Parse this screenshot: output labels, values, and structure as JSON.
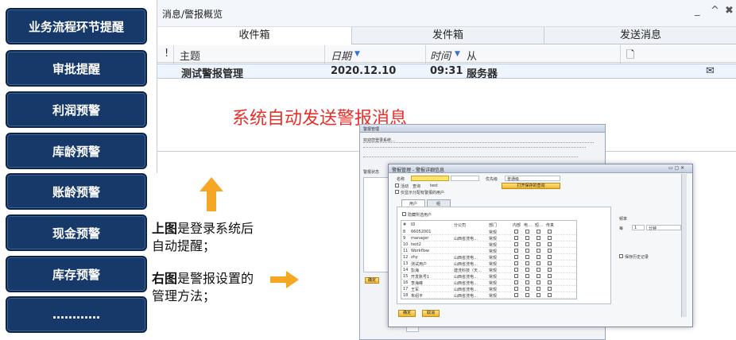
{
  "sidebar": {
    "items": [
      {
        "label": "业务流程环节提醒"
      },
      {
        "label": "审批提醒"
      },
      {
        "label": "利润预警"
      },
      {
        "label": "库龄预警"
      },
      {
        "label": "账龄预警"
      },
      {
        "label": "现金预警"
      },
      {
        "label": "库存预警"
      },
      {
        "label": "…………"
      }
    ]
  },
  "window": {
    "title": "消息/警报概览",
    "tabs": [
      "收件箱",
      "发件箱",
      "发送消息"
    ],
    "columns": {
      "flag": "!",
      "subject": "主题",
      "date": "日期",
      "time": "时间",
      "from": "从"
    },
    "row": {
      "subject": "测试警报管理",
      "date": "2020.12.10",
      "time": "09:31",
      "from": "服务器"
    }
  },
  "headline": "系统自动发送警报消息",
  "captions": {
    "top_bold": "上图",
    "top_rest1": "是登录系统后",
    "top_rest2": "自动提醒；",
    "right_bold": "右图",
    "right_rest1": "是警报设置的",
    "right_rest2": "管理方法；"
  },
  "dialog_back": {
    "title": "警报管理",
    "line1": "欢迎您登录系统…",
    "state_label": "警报状态",
    "ok": "确定"
  },
  "dialog": {
    "title": "警报管理 - 警报详细信息",
    "name_label": "名称",
    "priority_label": "优先级",
    "priority_value": "普通级",
    "active_label": "活动",
    "query_label": "查询",
    "query_value": "test",
    "open_query_button": "打开保存的查询",
    "only_show_label": "仅显示分配有警报的用户",
    "tab_users": "用户",
    "tab_group": "组",
    "hide_label": "隐藏所选用户",
    "frequency_label": "频率",
    "every_label": "每",
    "every_value": "1",
    "unit_value": "分钟",
    "save_history_label": "保存历史记录",
    "ok": "确定",
    "cancel": "取消",
    "user_headers": [
      "#",
      "ID",
      "分公司",
      "部门",
      "内部",
      "电…",
      "短…",
      "传真"
    ],
    "users": [
      {
        "no": "8",
        "id": "66052001",
        "branch": "",
        "dept": "常规"
      },
      {
        "no": "9",
        "id": "manager",
        "branch": "山西省洗电…",
        "dept": "常规"
      },
      {
        "no": "10",
        "id": "test2",
        "branch": "",
        "dept": "常规"
      },
      {
        "no": "11",
        "id": "Workflow",
        "branch": "",
        "dept": "常规"
      },
      {
        "no": "12",
        "id": "zhy",
        "branch": "山西省洗电…",
        "dept": "常规"
      },
      {
        "no": "13",
        "id": "测试用户",
        "branch": "山西省洗电…",
        "dept": "常规"
      },
      {
        "no": "14",
        "id": "彭海",
        "branch": "建洗科技（天…",
        "dept": "常规"
      },
      {
        "no": "15",
        "id": "开发账号1",
        "branch": "山西省洗电…",
        "dept": "常规"
      },
      {
        "no": "16",
        "id": "李海峰",
        "branch": "山西省洗电…",
        "dept": "常规"
      },
      {
        "no": "17",
        "id": "王军",
        "branch": "山西省洗电…",
        "dept": "常规"
      },
      {
        "no": "18",
        "id": "朱绍平",
        "branch": "山西省洗电…",
        "dept": "常规"
      }
    ]
  },
  "colors": {
    "sidebar_bg": "#16396a",
    "headline": "#e8302a",
    "arrow": "#f5a623"
  }
}
